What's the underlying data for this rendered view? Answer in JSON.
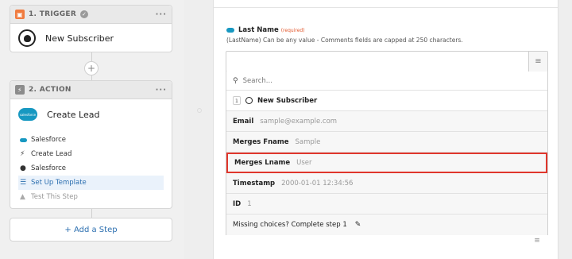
{
  "trigger": {
    "header": "1. TRIGGER",
    "app_name": "New Subscriber"
  },
  "action": {
    "header": "2. ACTION",
    "app_name": "Create Lead",
    "steps": [
      {
        "label": "Salesforce",
        "icon": "salesforce-icon"
      },
      {
        "label": "Create Lead",
        "icon": "bolt-icon"
      },
      {
        "label": "Salesforce",
        "icon": "user-icon"
      },
      {
        "label": "Set Up Template",
        "icon": "list-icon"
      },
      {
        "label": "Test This Step",
        "icon": "flask-icon"
      }
    ],
    "salesforce_logo_text": "salesforce"
  },
  "add_step_label": "+ Add a Step",
  "field": {
    "label": "Last Name",
    "required": "(required)",
    "help": "(LastName) Can be any value - Comments fields are capped at 250 characters."
  },
  "dropdown": {
    "search_placeholder": "Search...",
    "group_number": "1",
    "group_label": "New Subscriber",
    "items": [
      {
        "key": "Email",
        "value": "sample@example.com"
      },
      {
        "key": "Merges Fname",
        "value": "Sample"
      },
      {
        "key": "Merges Lname",
        "value": "User"
      },
      {
        "key": "Timestamp",
        "value": "2000-01-01 12:34:56"
      },
      {
        "key": "ID",
        "value": "1"
      }
    ],
    "missing_text": "Missing choices? Complete step 1"
  },
  "colors": {
    "accent": "#2c6fb0",
    "highlight_border": "#e0362c",
    "trigger_badge": "#f07b3f",
    "salesforce": "#1798c1"
  }
}
